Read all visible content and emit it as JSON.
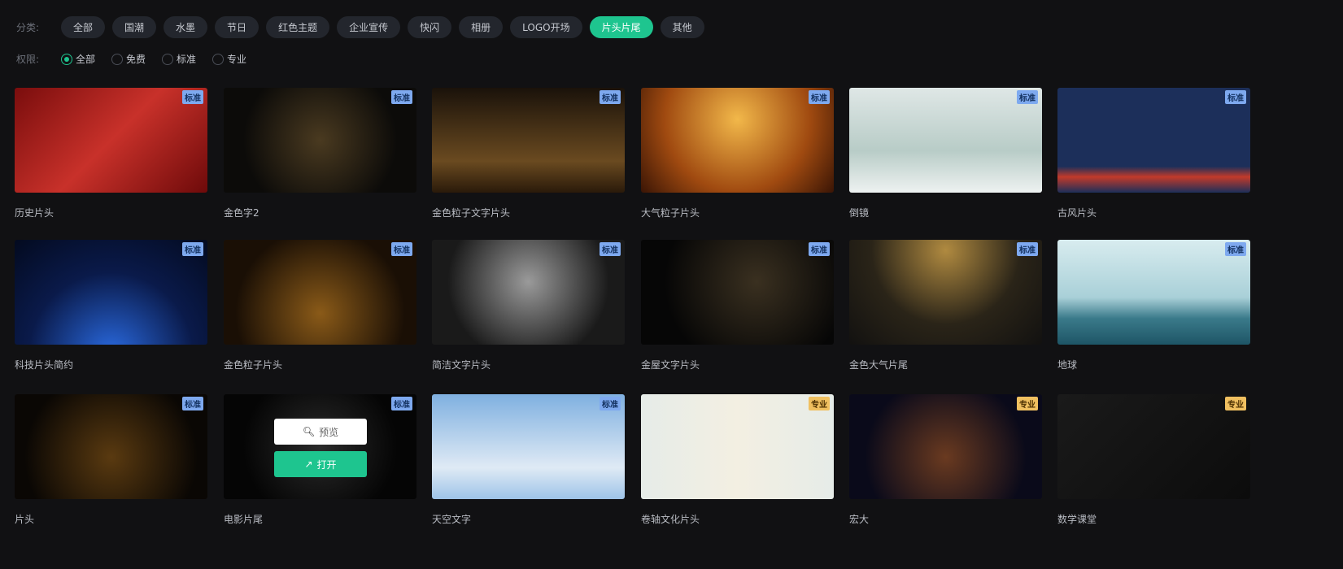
{
  "filters": {
    "category_label": "分类:",
    "categories": [
      "全部",
      "国潮",
      "水墨",
      "节日",
      "红色主题",
      "企业宣传",
      "快闪",
      "相册",
      "LOGO开场",
      "片头片尾",
      "其他"
    ],
    "active_category": "片头片尾",
    "permission_label": "权限:",
    "permissions": [
      "全部",
      "免费",
      "标准",
      "专业"
    ],
    "active_permission": "全部"
  },
  "overlay": {
    "preview": "预览",
    "open": "打开"
  },
  "cards": [
    {
      "name": "历史片头",
      "badge": "标准",
      "bg": "linear-gradient(135deg,#7a0d0d,#c8312a 50%,#6e0a0a)"
    },
    {
      "name": "金色字2",
      "badge": "标准",
      "bg": "radial-gradient(circle at 50% 50%,#4a3a20,#0c0b09 70%)"
    },
    {
      "name": "金色粒子文字片头",
      "badge": "标准",
      "bg": "linear-gradient(180deg,#1a120a,#6a4a20 70%,#2a1a0a)"
    },
    {
      "name": "大气粒子片头",
      "badge": "标准",
      "bg": "radial-gradient(circle at 50% 30%,#f2b84a,#a04a10 60%,#3a1505)"
    },
    {
      "name": "倒镜",
      "badge": "标准",
      "bg": "linear-gradient(180deg,#dfe7e6,#b8ccc7 60%,#eef2f1)"
    },
    {
      "name": "古风片头",
      "badge": "标准",
      "bg": "linear-gradient(180deg,#1c2f5a 75%,#c23a2a 85%,#1c2f5a)"
    },
    {
      "name": "科技片头简约",
      "badge": "标准",
      "bg": "radial-gradient(circle at 50% 110%,#2a6ae0,#0a1a4a 55%,#030a1f)"
    },
    {
      "name": "金色粒子片头",
      "badge": "标准",
      "bg": "radial-gradient(circle at 50% 70%,#8a5a18,#1a0f05 70%)"
    },
    {
      "name": "简洁文字片头",
      "badge": "标准",
      "bg": "radial-gradient(circle at 50% 40%,#9a9a9a,#1a1a1a 70%)"
    },
    {
      "name": "金屋文字片头",
      "badge": "标准",
      "bg": "radial-gradient(circle at 60% 40%,#3a3020,#060606 70%)"
    },
    {
      "name": "金色大气片尾",
      "badge": "标准",
      "bg": "radial-gradient(circle at 50% 10%,#b08a40,#2a2418 55%,#121110)"
    },
    {
      "name": "地球",
      "badge": "标准",
      "bg": "linear-gradient(180deg,#d8ecef,#a9d0d8 55%,#3a7a8a 75%,#1e5566)"
    },
    {
      "name": "片头",
      "badge": "标准",
      "bg": "radial-gradient(circle at 50% 60%,#5a3a10,#0a0704 75%)"
    },
    {
      "name": "电影片尾",
      "badge": "标准",
      "bg": "radial-gradient(circle at 50% 50%,#2a2a2a,#050505 70%)"
    },
    {
      "name": "天空文字",
      "badge": "标准",
      "bg": "linear-gradient(180deg,#7fb0e0,#dfeaf5 70%,#9ec4e8)"
    },
    {
      "name": "卷轴文化片头",
      "badge": "专业",
      "bg": "linear-gradient(90deg,#e6ece8,#f3efe2 50%,#e6ece8)"
    },
    {
      "name": "宏大",
      "badge": "专业",
      "bg": "radial-gradient(circle at 50% 60%,#6a3a20,#0a0a1a 70%)"
    },
    {
      "name": "数学课堂",
      "badge": "专业",
      "bg": "linear-gradient(135deg,#1a1a1a,#0c0c0c)"
    }
  ]
}
